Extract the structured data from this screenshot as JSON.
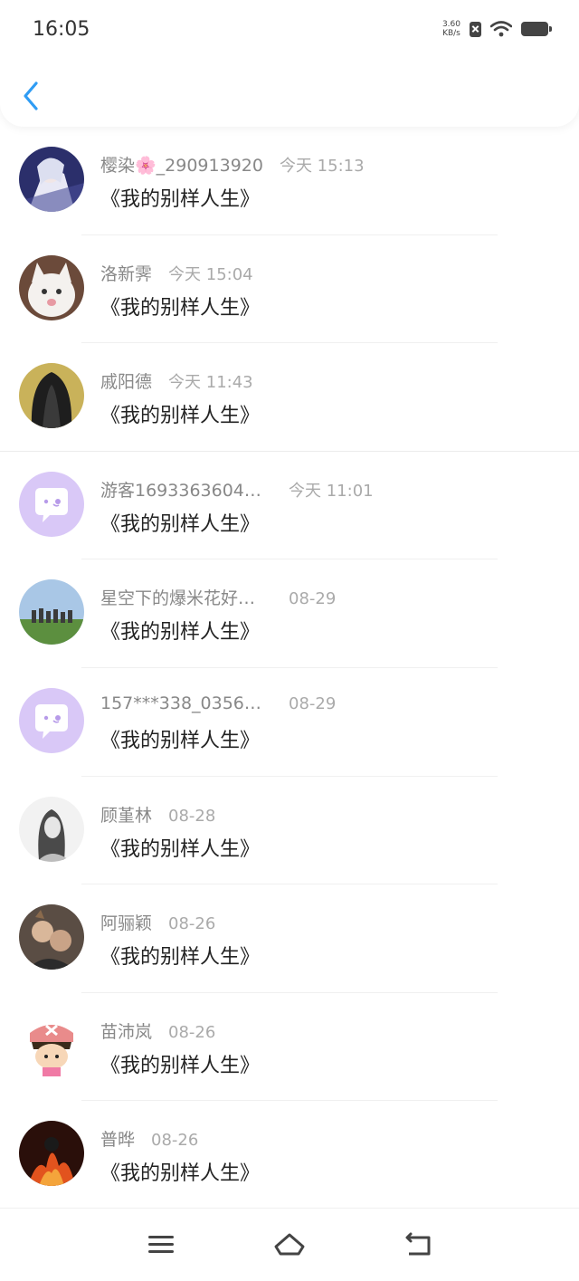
{
  "status_bar": {
    "time": "16:05",
    "net_speed_value": "3.60",
    "net_speed_unit": "KB/s"
  },
  "header": {
    "back_icon": "chevron-left-icon",
    "accent_color": "#2f9cf4"
  },
  "messages": [
    {
      "name": "樱染🌸_290913920",
      "time": "今天 15:13",
      "text": "《我的别样人生》",
      "avatar": "anime-white-hair"
    },
    {
      "name": "洛新霁",
      "time": "今天 15:04",
      "text": "《我的别样人生》",
      "avatar": "white-cat"
    },
    {
      "name": "戚阳德",
      "time": "今天 11:43",
      "text": "《我的别样人生》",
      "avatar": "long-black-hair"
    },
    {
      "name": "游客1693363604…",
      "time": "今天 11:01",
      "text": "《我的别样人生》",
      "avatar": "default-chat-bubble"
    },
    {
      "name": "星空下的爆米花好…",
      "time": "08-29",
      "text": "《我的别样人生》",
      "avatar": "group-photo-outdoor"
    },
    {
      "name": "157***338_0356…",
      "time": "08-29",
      "text": "《我的别样人生》",
      "avatar": "default-chat-bubble"
    },
    {
      "name": "顾堇林",
      "time": "08-28",
      "text": "《我的别样人生》",
      "avatar": "sketch-portrait"
    },
    {
      "name": "阿骊颖",
      "time": "08-26",
      "text": "《我的别样人生》",
      "avatar": "couple-with-cat"
    },
    {
      "name": "苗沛岚",
      "time": "08-26",
      "text": "《我的别样人生》",
      "avatar": "cartoon-chopper"
    },
    {
      "name": "普晔",
      "time": "08-26",
      "text": "《我的别样人生》",
      "avatar": "fire-figure"
    }
  ],
  "navbar": {
    "menu_icon": "menu-icon",
    "home_icon": "home-icon",
    "back_icon": "back-arrow-icon"
  }
}
